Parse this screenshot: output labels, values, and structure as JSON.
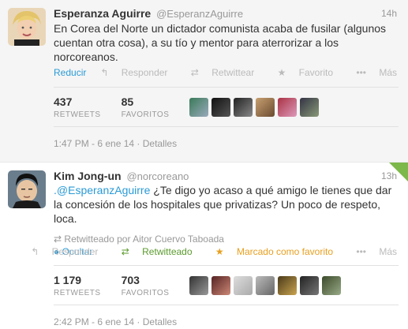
{
  "tweet1": {
    "name": "Esperanza Aguirre",
    "handle": "@EsperanzAguirre",
    "time": "14h",
    "text": "En Corea del Norte un dictador comunista acaba de fusilar (algunos cuentan otra cosa), a su tío y mentor para aterrorizar a los norcoreanos.",
    "collapse_label": "Reducir",
    "actions": {
      "reply": "Responder",
      "retweet": "Retwittear",
      "favorite": "Favorito",
      "more": "Más"
    },
    "retweets_count": "437",
    "retweets_label": "RETWEETS",
    "favorites_count": "85",
    "favorites_label": "FAVORITOS",
    "detail_time": "1:47 PM - 6 ene 14",
    "details_link": "Detalles"
  },
  "tweet2": {
    "name": "Kim Jong-un",
    "handle": "@norcoreano",
    "time": "13h",
    "mention": ".@EsperanzAguirre",
    "text": "¿Te digo yo acaso a qué amigo le tienes que dar la concesión de los hospitales que privatizas? Un poco de respeto, loca.",
    "retweeted_by": "Retwitteado por Aitor Cuervo Taboada",
    "hide_label": "Ocultar",
    "actions": {
      "reply": "Responder",
      "retweeted": "Retwitteado",
      "favorited": "Marcado como favorito",
      "more": "Más"
    },
    "retweets_count": "1 179",
    "retweets_label": "RETWEETS",
    "favorites_count": "703",
    "favorites_label": "FAVORITOS",
    "detail_time": "2:42 PM - 6 ene 14",
    "details_link": "Detalles"
  },
  "colors": {
    "link": "#2a9ad6",
    "retweeted": "#5a9a2c",
    "favorited": "#e8a020",
    "corner_badge": "#7db84b"
  }
}
